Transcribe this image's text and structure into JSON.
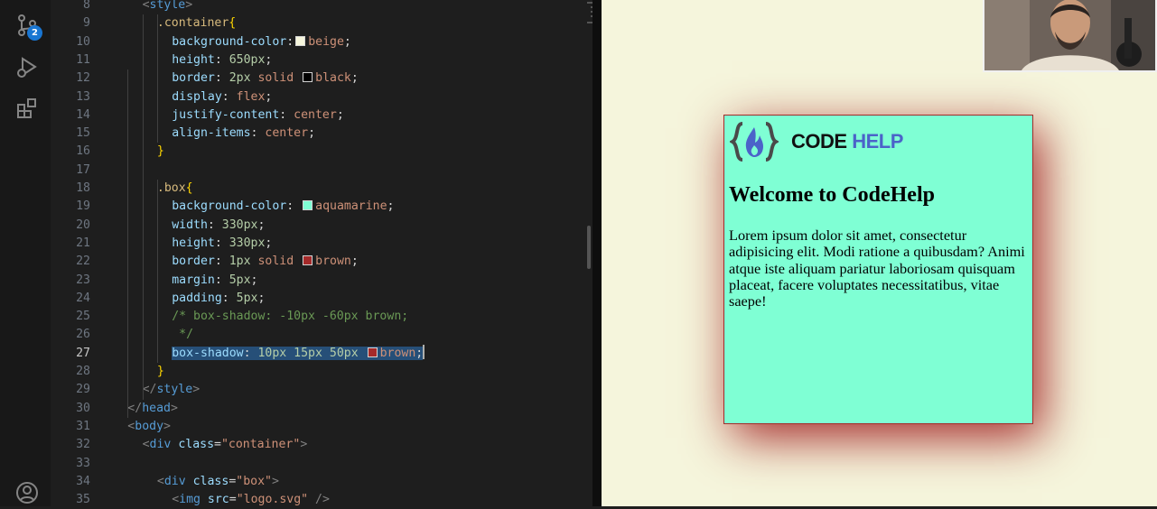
{
  "activity_bar": {
    "source_control_badge": "2"
  },
  "editor": {
    "lines": [
      {
        "n": "8",
        "tokens": [
          [
            "tag",
            "<"
          ],
          [
            "tagname",
            "style"
          ],
          [
            "tag",
            ">"
          ]
        ]
      },
      {
        "n": "9",
        "tokens": [
          [
            "sel-name",
            ".container"
          ],
          [
            "brace",
            "{"
          ]
        ]
      },
      {
        "n": "10",
        "tokens": [
          [
            "prop",
            "background-color"
          ],
          [
            "punct",
            ":"
          ],
          [
            "swatch",
            "#f5f5dc"
          ],
          [
            "val",
            "beige"
          ],
          [
            "punct",
            ";"
          ]
        ]
      },
      {
        "n": "11",
        "tokens": [
          [
            "prop",
            "height"
          ],
          [
            "punct",
            ": "
          ],
          [
            "num",
            "650px"
          ],
          [
            "punct",
            ";"
          ]
        ]
      },
      {
        "n": "12",
        "tokens": [
          [
            "prop",
            "border"
          ],
          [
            "punct",
            ": "
          ],
          [
            "num",
            "2px"
          ],
          [
            "val",
            " solid "
          ],
          [
            "swatch",
            "#000000"
          ],
          [
            "val",
            "black"
          ],
          [
            "punct",
            ";"
          ]
        ]
      },
      {
        "n": "13",
        "tokens": [
          [
            "prop",
            "display"
          ],
          [
            "punct",
            ": "
          ],
          [
            "val",
            "flex"
          ],
          [
            "punct",
            ";"
          ]
        ]
      },
      {
        "n": "14",
        "tokens": [
          [
            "prop",
            "justify-content"
          ],
          [
            "punct",
            ": "
          ],
          [
            "val",
            "center"
          ],
          [
            "punct",
            ";"
          ]
        ]
      },
      {
        "n": "15",
        "tokens": [
          [
            "prop",
            "align-items"
          ],
          [
            "punct",
            ": "
          ],
          [
            "val",
            "center"
          ],
          [
            "punct",
            ";"
          ]
        ]
      },
      {
        "n": "16",
        "tokens": [
          [
            "brace",
            "}"
          ]
        ]
      },
      {
        "n": "17",
        "tokens": []
      },
      {
        "n": "18",
        "tokens": [
          [
            "sel-name",
            ".box"
          ],
          [
            "brace",
            "{"
          ]
        ]
      },
      {
        "n": "19",
        "tokens": [
          [
            "prop",
            "background-color"
          ],
          [
            "punct",
            ": "
          ],
          [
            "swatch",
            "#7fffd4"
          ],
          [
            "val",
            "aquamarine"
          ],
          [
            "punct",
            ";"
          ]
        ]
      },
      {
        "n": "20",
        "tokens": [
          [
            "prop",
            "width"
          ],
          [
            "punct",
            ": "
          ],
          [
            "num",
            "330px"
          ],
          [
            "punct",
            ";"
          ]
        ]
      },
      {
        "n": "21",
        "tokens": [
          [
            "prop",
            "height"
          ],
          [
            "punct",
            ": "
          ],
          [
            "num",
            "330px"
          ],
          [
            "punct",
            ";"
          ]
        ]
      },
      {
        "n": "22",
        "tokens": [
          [
            "prop",
            "border"
          ],
          [
            "punct",
            ": "
          ],
          [
            "num",
            "1px"
          ],
          [
            "val",
            " solid "
          ],
          [
            "swatch",
            "#a52a2a"
          ],
          [
            "val",
            "brown"
          ],
          [
            "punct",
            ";"
          ]
        ]
      },
      {
        "n": "23",
        "tokens": [
          [
            "prop",
            "margin"
          ],
          [
            "punct",
            ": "
          ],
          [
            "num",
            "5px"
          ],
          [
            "punct",
            ";"
          ]
        ]
      },
      {
        "n": "24",
        "tokens": [
          [
            "prop",
            "padding"
          ],
          [
            "punct",
            ": "
          ],
          [
            "num",
            "5px"
          ],
          [
            "punct",
            ";"
          ]
        ]
      },
      {
        "n": "25",
        "tokens": [
          [
            "cmt",
            "/* box-shadow: -10px -60px brown;"
          ]
        ]
      },
      {
        "n": "26",
        "tokens": [
          [
            "cmt",
            " */"
          ]
        ]
      },
      {
        "n": "27",
        "tokens": [
          [
            "prop",
            "box-shadow"
          ],
          [
            "punct",
            ": "
          ],
          [
            "num",
            "10px 15px 50px "
          ],
          [
            "swatch",
            "#a52a2a"
          ],
          [
            "val",
            "brown"
          ],
          [
            "punct",
            ";"
          ]
        ]
      },
      {
        "n": "28",
        "tokens": [
          [
            "brace",
            "}"
          ]
        ]
      },
      {
        "n": "29",
        "tokens": [
          [
            "tag",
            "</"
          ],
          [
            "tagname",
            "style"
          ],
          [
            "tag",
            ">"
          ]
        ]
      },
      {
        "n": "30",
        "tokens": [
          [
            "tag",
            "</"
          ],
          [
            "tagname",
            "head"
          ],
          [
            "tag",
            ">"
          ]
        ]
      },
      {
        "n": "31",
        "tokens": [
          [
            "tag",
            "<"
          ],
          [
            "tagname",
            "body"
          ],
          [
            "tag",
            ">"
          ]
        ]
      },
      {
        "n": "32",
        "tokens": [
          [
            "tag",
            "<"
          ],
          [
            "tagname",
            "div"
          ],
          [
            "attr",
            " class"
          ],
          [
            "punct",
            "="
          ],
          [
            "str",
            "\"container\""
          ],
          [
            "tag",
            ">"
          ]
        ]
      },
      {
        "n": "33",
        "tokens": []
      },
      {
        "n": "34",
        "tokens": [
          [
            "tag",
            "<"
          ],
          [
            "tagname",
            "div"
          ],
          [
            "attr",
            " class"
          ],
          [
            "punct",
            "="
          ],
          [
            "str",
            "\"box\""
          ],
          [
            "tag",
            ">"
          ]
        ]
      },
      {
        "n": "35",
        "tokens": [
          [
            "tag",
            "<"
          ],
          [
            "tagname",
            "img"
          ],
          [
            "attr",
            " src"
          ],
          [
            "punct",
            "="
          ],
          [
            "str",
            "\"logo.svg\""
          ],
          [
            "tag",
            " />"
          ]
        ]
      }
    ],
    "active_line": "27"
  },
  "preview": {
    "logo_code": "CODE",
    "logo_help": "HELP",
    "heading": "Welcome to CodeHelp",
    "paragraph": "Lorem ipsum dolor sit amet, consectetur adipisicing elit. Modi ratione a quibusdam? Animi atque iste aliquam pariatur laboriosam quisquam placeat, facere voluptates necessitatibus, vitae saepe!"
  },
  "colors": {
    "editor_bg": "#1e1e1e",
    "preview_bg": "#f5f5dc",
    "box_bg": "#7fffd4",
    "box_border": "#a52a2a",
    "logo_help": "#4b63c9"
  }
}
